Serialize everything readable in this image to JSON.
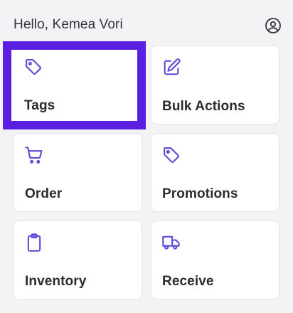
{
  "header": {
    "greeting": "Hello, Kemea Vori",
    "profile_icon": "user-circle-icon"
  },
  "accent_color": "#5b4bdb",
  "selection_color": "#5a1fe0",
  "tiles": [
    {
      "label": "Tags",
      "icon": "tag-icon",
      "selected": true
    },
    {
      "label": "Bulk Actions",
      "icon": "edit-icon",
      "selected": false
    },
    {
      "label": "Order",
      "icon": "shopping-cart-icon",
      "selected": false
    },
    {
      "label": "Promotions",
      "icon": "tag-icon",
      "selected": false
    },
    {
      "label": "Inventory",
      "icon": "clipboard-icon",
      "selected": false
    },
    {
      "label": "Receive",
      "icon": "truck-icon",
      "selected": false
    }
  ]
}
